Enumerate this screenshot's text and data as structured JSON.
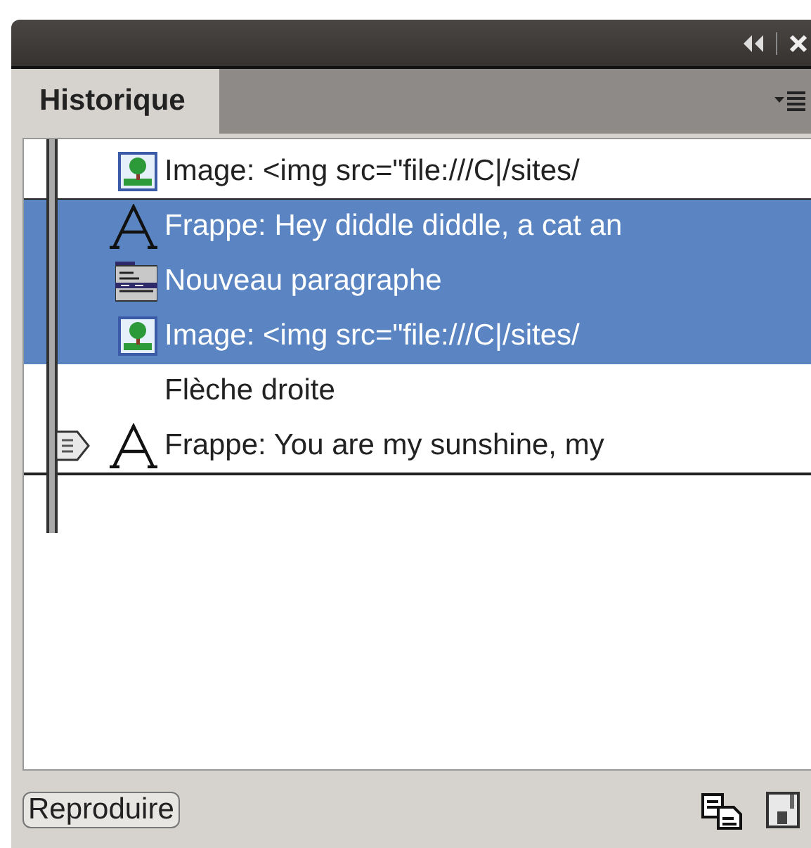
{
  "panel": {
    "tab": {
      "label": "Historique",
      "selected": true
    }
  },
  "steps": [
    {
      "kind": "image",
      "label": "Image: <img src=\"file:///C|/sites/",
      "selected": false,
      "current": false
    },
    {
      "kind": "typing",
      "label": "Frappe: Hey diddle diddle, a cat an",
      "selected": true,
      "current": false
    },
    {
      "kind": "paragraph",
      "label": "Nouveau paragraphe",
      "selected": true,
      "current": false
    },
    {
      "kind": "image",
      "label": "Image: <img src=\"file:///C|/sites/",
      "selected": true,
      "current": false
    },
    {
      "kind": "none",
      "label": "Flèche droite",
      "selected": false,
      "current": false
    },
    {
      "kind": "typing",
      "label": "Frappe: You are my sunshine, my",
      "selected": false,
      "current": true
    }
  ],
  "footer": {
    "button": "Reproduire"
  }
}
